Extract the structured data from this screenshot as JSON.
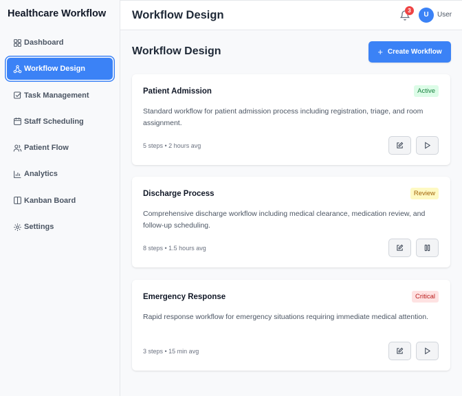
{
  "app": {
    "title": "Healthcare Workflow"
  },
  "sidebar": {
    "items": [
      {
        "label": "Dashboard",
        "icon": "grid-icon",
        "active": false
      },
      {
        "label": "Workflow Design",
        "icon": "workflow-icon",
        "active": true
      },
      {
        "label": "Task Management",
        "icon": "checkbox-icon",
        "active": false
      },
      {
        "label": "Staff Scheduling",
        "icon": "calendar-icon",
        "active": false
      },
      {
        "label": "Patient Flow",
        "icon": "users-icon",
        "active": false
      },
      {
        "label": "Analytics",
        "icon": "bar-chart-icon",
        "active": false
      },
      {
        "label": "Kanban Board",
        "icon": "columns-icon",
        "active": false
      },
      {
        "label": "Settings",
        "icon": "gear-icon",
        "active": false
      }
    ]
  },
  "header": {
    "title": "Workflow Design",
    "notification_count": "3",
    "avatar_initial": "U",
    "user_name": "User"
  },
  "main": {
    "title": "Workflow Design",
    "create_button_label": "Create Workflow",
    "workflows": [
      {
        "name": "Patient Admission",
        "status": "Active",
        "description": "Standard workflow for patient admission process including registration, triage, and room assignment.",
        "meta": "5 steps • 2 hours avg",
        "action_icon": "play-icon"
      },
      {
        "name": "Discharge Process",
        "status": "Review",
        "description": "Comprehensive discharge workflow including medical clearance, medication review, and follow-up scheduling.",
        "meta": "8 steps • 1.5 hours avg",
        "action_icon": "pause-icon"
      },
      {
        "name": "Emergency Response",
        "status": "Critical",
        "description": "Rapid response workflow for emergency situations requiring immediate medical attention.",
        "meta": "3 steps • 15 min avg",
        "action_icon": "play-icon"
      }
    ]
  },
  "colors": {
    "accent": "#3b82f6",
    "status_active": "#15803d",
    "status_review": "#a16207",
    "status_critical": "#b91c1c",
    "notification": "#ef4444"
  }
}
